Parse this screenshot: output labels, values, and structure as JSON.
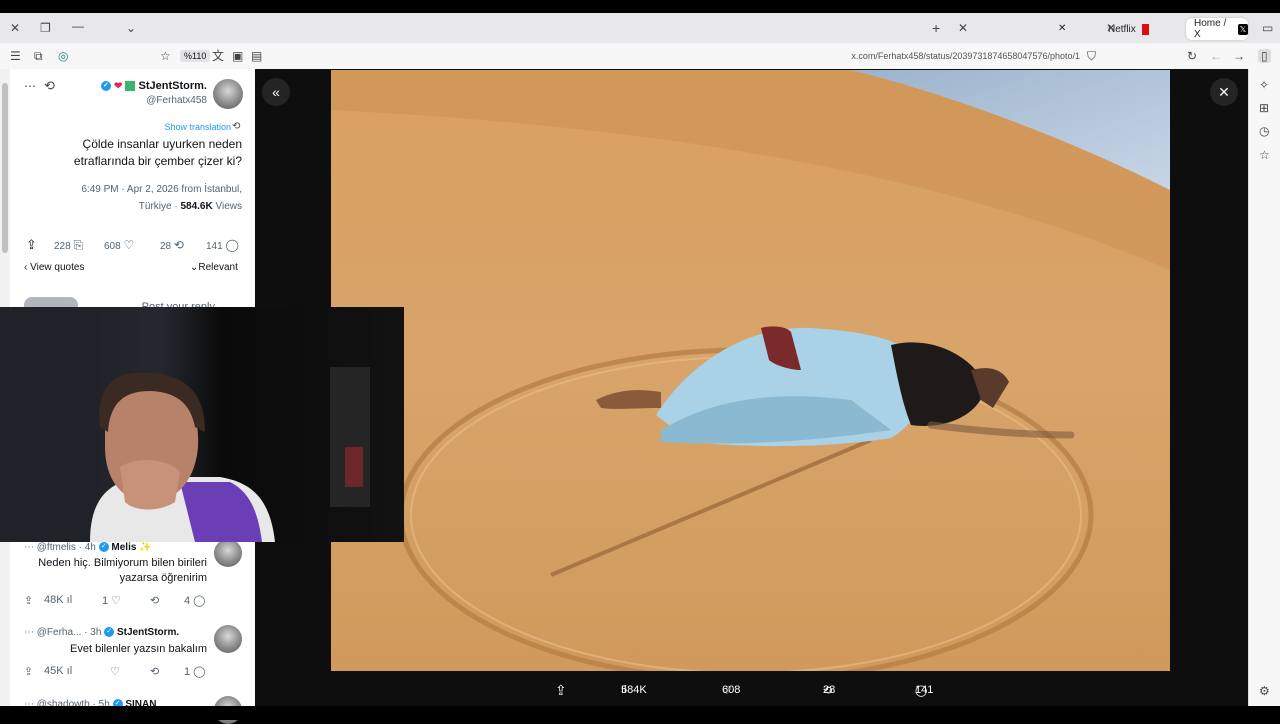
{
  "browser": {
    "tabs": [
      {
        "label": "Home / X",
        "favicon": "x-icon"
      },
      {
        "label": "Netflix",
        "favicon": "netflix-icon"
      }
    ],
    "url": "x.com/Ferhatx458/status/2039731874658047576/photo/1",
    "zoom": "%110"
  },
  "tweet": {
    "author_name": "StJentStorm.",
    "author_handle": "@Ferhatx458",
    "show_translation": "Show translation",
    "text_line1": "Çölde insanlar uyurken neden",
    "text_line2": "etraflarında bir çember çizer ki?",
    "meta_line1": "6:49 PM · Apr 2, 2026 from İstanbul,",
    "meta_line2": "Türkiye · ",
    "views_count": "584.6K",
    "views_label": " Views",
    "replies": "141",
    "reposts": "28",
    "likes": "608",
    "bookmarks": "228",
    "sort_label": "Relevant",
    "view_quotes": "View quotes",
    "reply_placeholder": "Post your reply"
  },
  "replies": [
    {
      "name": "Melis ✨",
      "handle": "@ftmelis · 4h",
      "text_line1": "Neden hiç. Bilmiyorum bilen birileri",
      "text_line2": "yazarsa öğrenirim",
      "comments": "4",
      "likes": "1",
      "views": "48K"
    },
    {
      "name": "StJentStorm.",
      "handle": "@Ferha... · 3h",
      "text_line1": "Evet bilenler yazsın bakalım",
      "comments": "1",
      "views": "45K"
    },
    {
      "name": "SINAN",
      "handle": "@shadowtb · 5h"
    }
  ],
  "photo_actions": {
    "views": "584K",
    "likes": "608",
    "reposts": "28",
    "replies": "141"
  },
  "colors": {
    "accent": "#1d9bf0",
    "sand": "#d9a061",
    "netflix": "#e50914"
  }
}
